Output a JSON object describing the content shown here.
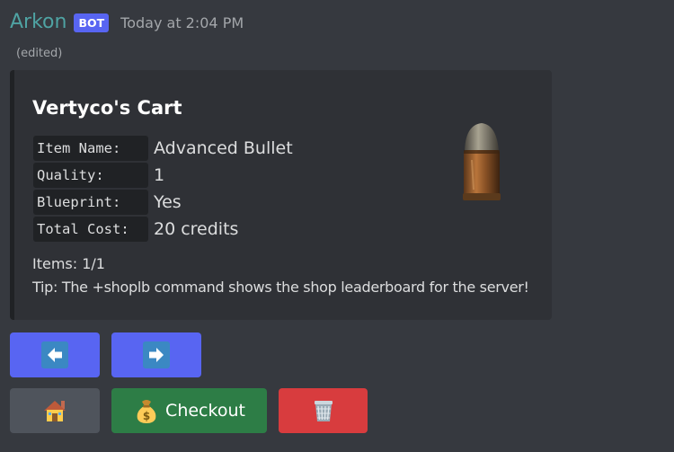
{
  "message": {
    "author": "Arkon",
    "badge": "BOT",
    "timestamp": "Today at 2:04 PM",
    "edited": "(edited)"
  },
  "embed": {
    "title": "Vertyco's Cart",
    "fields": [
      {
        "label": "Item Name:",
        "value": "Advanced Bullet"
      },
      {
        "label": "Quality:",
        "value": "1"
      },
      {
        "label": "Blueprint:",
        "value": "Yes"
      },
      {
        "label": "Total Cost:",
        "value": "20 credits"
      }
    ],
    "items_count": "Items: 1/1",
    "tip": "Tip: The +shoplb command shows the shop leaderboard for the server!",
    "thumbnail_icon": "bullet-icon"
  },
  "buttons": {
    "previous_icon": "left-arrow-icon",
    "next_icon": "right-arrow-icon",
    "home_icon": "house-icon",
    "checkout_label": "Checkout",
    "checkout_icon": "money-bag-icon",
    "delete_icon": "wastebasket-icon"
  },
  "colors": {
    "background": "#36393f",
    "embed_background": "#2f3136",
    "blurple": "#5865f2",
    "success": "#2d7d46",
    "danger": "#d83c3e",
    "secondary": "#4f545c",
    "author": "#4fa3a3"
  }
}
